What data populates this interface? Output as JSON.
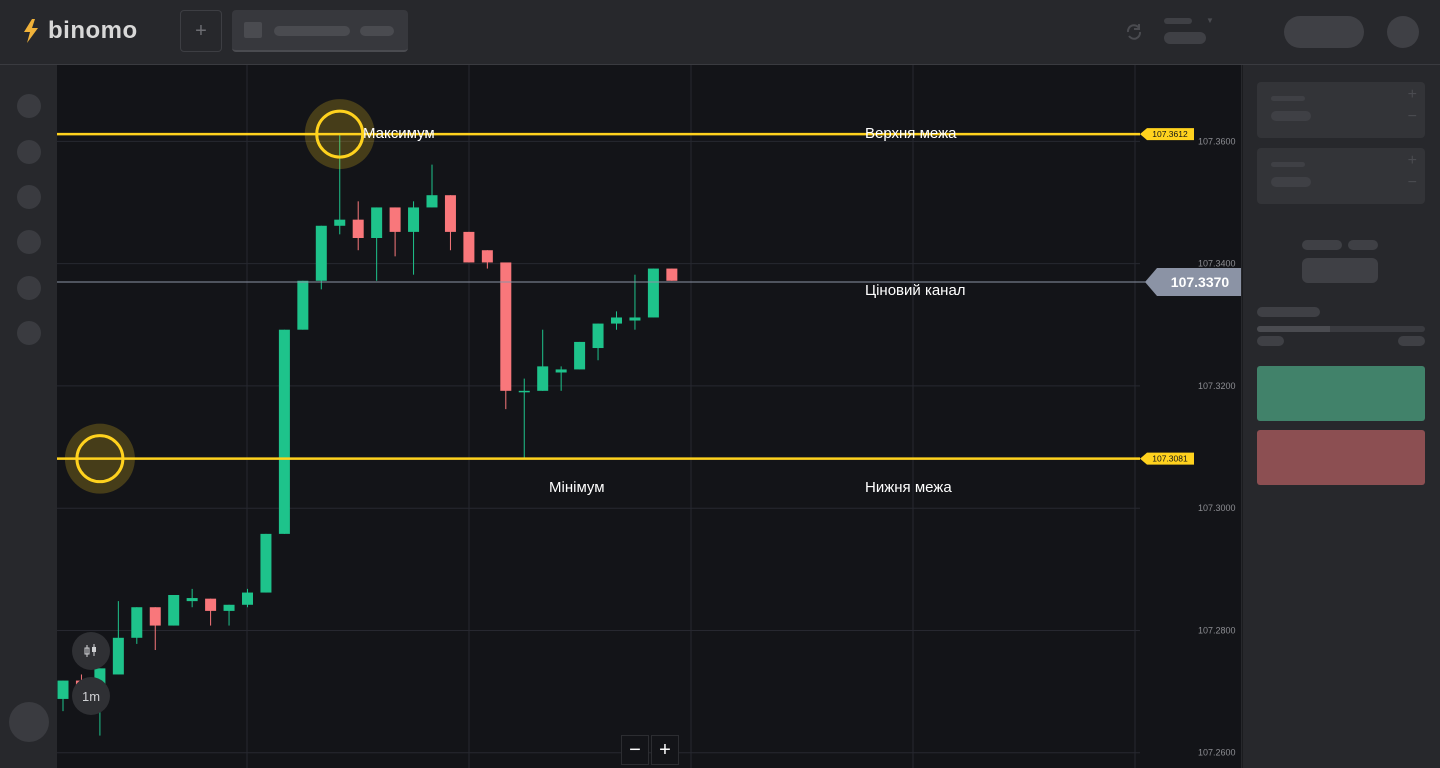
{
  "header": {
    "logo_text": "binomo",
    "add_tab_label": "+"
  },
  "colors": {
    "up": "#1ec38b",
    "down": "#f9777b",
    "level": "#ffd21e",
    "current_price": "#8b93a5",
    "background": "#131418"
  },
  "chart_data": {
    "type": "candlestick",
    "ylim": [
      107.2575,
      107.3725
    ],
    "yticks": [
      "107.2600",
      "107.2800",
      "107.3000",
      "107.3200",
      "107.3400",
      "107.3600"
    ],
    "current_price": {
      "value": 107.337,
      "label": "107.3370"
    },
    "levels": [
      {
        "value": 107.3612,
        "label": "107.3612"
      },
      {
        "value": 107.3081,
        "label": "107.3081"
      }
    ],
    "annotations": {
      "maximum": "Максимум",
      "upper": "Верхня межа",
      "channel": "Ціновий канал",
      "minimum": "Мінімум",
      "lower": "Нижня межа"
    },
    "timeframe": "1m",
    "candles": [
      {
        "o": 107.2688,
        "h": 107.2718,
        "l": 107.2668,
        "c": 107.2718
      },
      {
        "o": 107.2718,
        "h": 107.2728,
        "l": 107.2678,
        "c": 107.2688
      },
      {
        "o": 107.2688,
        "h": 107.2738,
        "l": 107.2628,
        "c": 107.2738
      },
      {
        "o": 107.2728,
        "h": 107.2848,
        "l": 107.2728,
        "c": 107.2788
      },
      {
        "o": 107.2788,
        "h": 107.2838,
        "l": 107.2778,
        "c": 107.2838
      },
      {
        "o": 107.2838,
        "h": 107.2838,
        "l": 107.2768,
        "c": 107.2808
      },
      {
        "o": 107.2808,
        "h": 107.2858,
        "l": 107.2808,
        "c": 107.2858
      },
      {
        "o": 107.2848,
        "h": 107.2868,
        "l": 107.2838,
        "c": 107.2853
      },
      {
        "o": 107.2852,
        "h": 107.2852,
        "l": 107.2808,
        "c": 107.2832
      },
      {
        "o": 107.2832,
        "h": 107.2838,
        "l": 107.2808,
        "c": 107.2842
      },
      {
        "o": 107.2842,
        "h": 107.2868,
        "l": 107.2838,
        "c": 107.2862
      },
      {
        "o": 107.2862,
        "h": 107.2938,
        "l": 107.2862,
        "c": 107.2958
      },
      {
        "o": 107.2958,
        "h": 107.3038,
        "l": 107.2958,
        "c": 107.3292
      },
      {
        "o": 107.3292,
        "h": 107.3362,
        "l": 107.3292,
        "c": 107.3372
      },
      {
        "o": 107.3372,
        "h": 107.3438,
        "l": 107.3358,
        "c": 107.3462
      },
      {
        "o": 107.3462,
        "h": 107.3612,
        "l": 107.3448,
        "c": 107.3472
      },
      {
        "o": 107.3472,
        "h": 107.3502,
        "l": 107.3422,
        "c": 107.3442
      },
      {
        "o": 107.3442,
        "h": 107.3472,
        "l": 107.3372,
        "c": 107.3492
      },
      {
        "o": 107.3492,
        "h": 107.3492,
        "l": 107.3412,
        "c": 107.3452
      },
      {
        "o": 107.3452,
        "h": 107.3502,
        "l": 107.3382,
        "c": 107.3492
      },
      {
        "o": 107.3492,
        "h": 107.3562,
        "l": 107.3492,
        "c": 107.3512
      },
      {
        "o": 107.3512,
        "h": 107.3512,
        "l": 107.3422,
        "c": 107.3452
      },
      {
        "o": 107.3452,
        "h": 107.3452,
        "l": 107.3402,
        "c": 107.3402
      },
      {
        "o": 107.3422,
        "h": 107.3422,
        "l": 107.3392,
        "c": 107.3402
      },
      {
        "o": 107.3402,
        "h": 107.3402,
        "l": 107.3162,
        "c": 107.3192
      },
      {
        "o": 107.3192,
        "h": 107.3212,
        "l": 107.3082,
        "c": 107.3192
      },
      {
        "o": 107.3192,
        "h": 107.3292,
        "l": 107.3192,
        "c": 107.3232
      },
      {
        "o": 107.3222,
        "h": 107.3232,
        "l": 107.3192,
        "c": 107.3227
      },
      {
        "o": 107.3227,
        "h": 107.3272,
        "l": 107.3227,
        "c": 107.3272
      },
      {
        "o": 107.3262,
        "h": 107.3302,
        "l": 107.3242,
        "c": 107.3302
      },
      {
        "o": 107.3302,
        "h": 107.3322,
        "l": 107.3292,
        "c": 107.3312
      },
      {
        "o": 107.3307,
        "h": 107.3382,
        "l": 107.3292,
        "c": 107.3312
      },
      {
        "o": 107.3312,
        "h": 107.3382,
        "l": 107.3312,
        "c": 107.3392
      },
      {
        "o": 107.3392,
        "h": 107.3392,
        "l": 107.3372,
        "c": 107.3372
      }
    ]
  }
}
